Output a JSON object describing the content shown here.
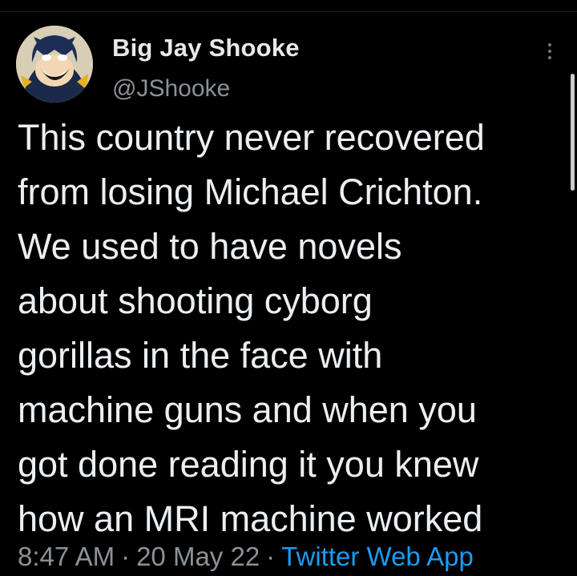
{
  "user": {
    "display_name": "Big Jay Shooke",
    "handle": "@JShooke",
    "avatar_icon": "cartoon-hero-avatar"
  },
  "tweet": {
    "lines": [
      "This country never recovered",
      "from losing Michael Crichton.",
      "We used to have novels",
      "about shooting cyborg",
      "gorillas in the face with",
      "machine guns and when you",
      "got done reading it you knew",
      "how an MRI machine worked"
    ],
    "time": "8:47 AM",
    "separator": "·",
    "date": "20 May 22",
    "source": "Twitter Web App"
  },
  "colors": {
    "background": "#000000",
    "text": "#e7e9ea",
    "muted": "#8b9197",
    "link": "#1d9bf0"
  },
  "icons": {
    "more": "more-vertical-icon"
  }
}
